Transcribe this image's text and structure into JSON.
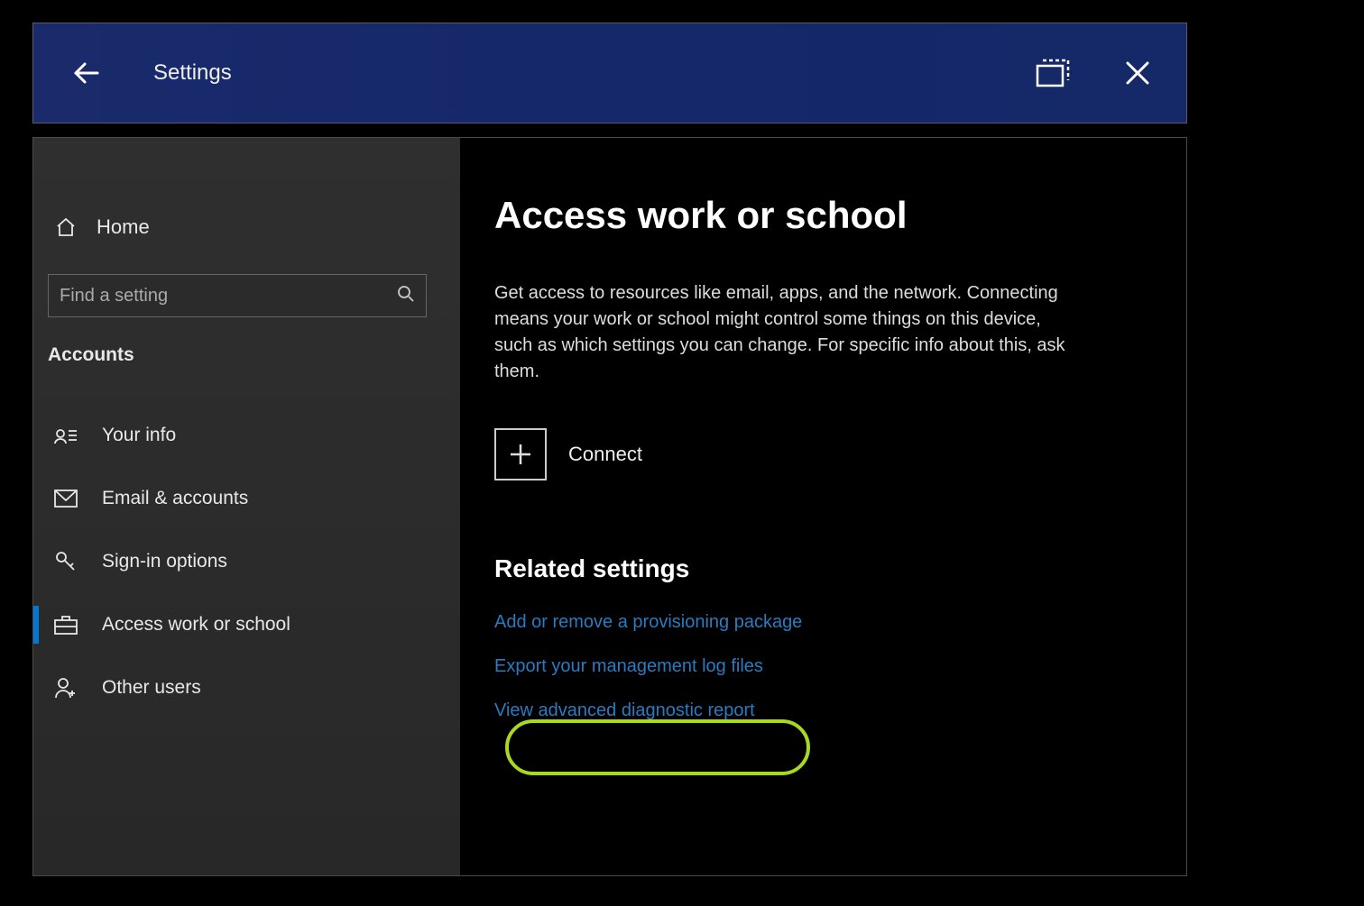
{
  "titlebar": {
    "title": "Settings"
  },
  "sidebar": {
    "home_label": "Home",
    "search_placeholder": "Find a setting",
    "category_label": "Accounts",
    "items": [
      {
        "label": "Your info",
        "icon": "person-card-icon"
      },
      {
        "label": "Email & accounts",
        "icon": "mail-icon"
      },
      {
        "label": "Sign-in options",
        "icon": "key-icon"
      },
      {
        "label": "Access work or school",
        "icon": "briefcase-icon"
      },
      {
        "label": "Other users",
        "icon": "person-add-icon"
      }
    ]
  },
  "main": {
    "heading": "Access work or school",
    "description": "Get access to resources like email, apps, and the network. Connecting means your work or school might control some things on this device, such as which settings you can change. For specific info about this, ask them.",
    "connect_label": "Connect",
    "related_heading": "Related settings",
    "links": [
      "Add or remove a provisioning package",
      "Export your management log files",
      "View advanced diagnostic report"
    ]
  },
  "annotation": {
    "highlighted_link_index": 2
  },
  "colors": {
    "accent": "#0078d4",
    "link": "#2b7bc0",
    "highlight": "#a8d820",
    "titlebar_bg": "#162a6a"
  }
}
